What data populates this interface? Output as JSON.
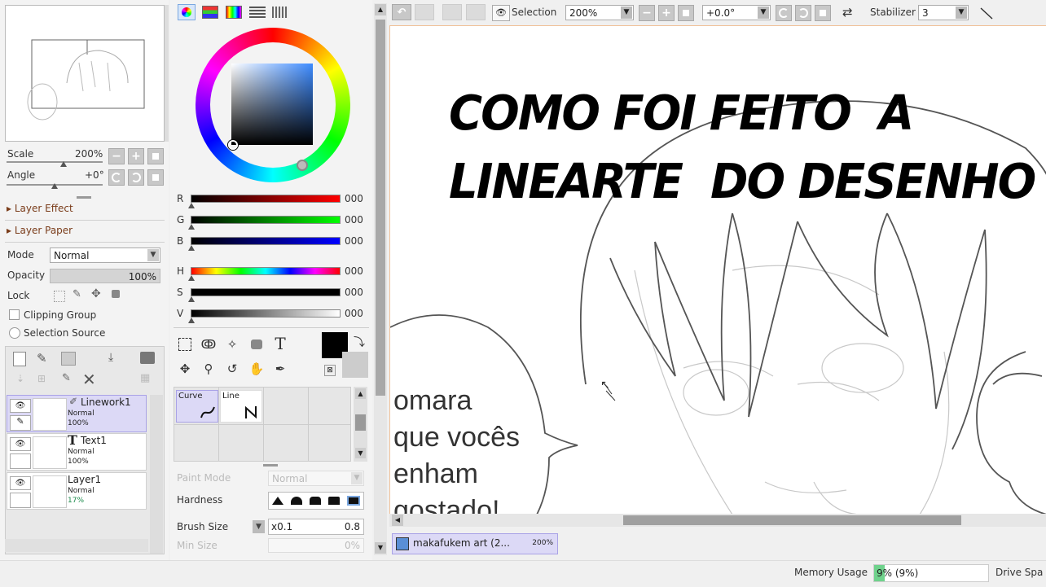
{
  "navigator": {
    "scale_label": "Scale",
    "scale_value": "200%",
    "angle_label": "Angle",
    "angle_value": "+0°"
  },
  "layer_panel": {
    "layer_effect": "Layer Effect",
    "layer_paper": "Layer Paper",
    "mode_label": "Mode",
    "mode_value": "Normal",
    "opacity_label": "Opacity",
    "opacity_value": "100%",
    "lock_label": "Lock",
    "clipping_group": "Clipping Group",
    "selection_source": "Selection Source",
    "layers": [
      {
        "name": "Linework1",
        "mode": "Normal",
        "opacity": "100%"
      },
      {
        "name": "Text1",
        "mode": "Normal",
        "opacity": "100%"
      },
      {
        "name": "Layer1",
        "mode": "Normal",
        "opacity": "17%"
      }
    ]
  },
  "color_panel": {
    "sliders": [
      {
        "label": "R",
        "value": "000"
      },
      {
        "label": "G",
        "value": "000"
      },
      {
        "label": "B",
        "value": "000"
      },
      {
        "label": "H",
        "value": "000"
      },
      {
        "label": "S",
        "value": "000"
      },
      {
        "label": "V",
        "value": "000"
      }
    ]
  },
  "brush_panel": {
    "brushes": [
      {
        "name": "Curve"
      },
      {
        "name": "Line"
      }
    ],
    "paint_mode_label": "Paint Mode",
    "paint_mode_value": "Normal",
    "hardness_label": "Hardness",
    "brush_size_label": "Brush Size",
    "brush_size_mult": "x0.1",
    "brush_size_value": "0.8",
    "min_size_label": "Min Size",
    "min_size_value": "0%"
  },
  "toolbar": {
    "selection_label": "Selection",
    "zoom_value": "200%",
    "rotation_value": "+0.0°",
    "stabilizer_label": "Stabilizer",
    "stabilizer_value": "3"
  },
  "canvas": {
    "title_line1": "COMO FOI FEITO  A",
    "title_line2": "LINEARTE  DO DESENHO",
    "speech_lines": [
      "omara",
      "que vocês",
      "enham",
      "gostado!"
    ]
  },
  "document_tab": {
    "name": "makafukem art (2...",
    "zoom": "200%"
  },
  "status_bar": {
    "memory_label": "Memory Usage",
    "memory_value": "9% (9%)",
    "memory_fraction": 0.09,
    "drive_label": "Drive Spa"
  },
  "colors": {
    "selected_layer_bg": "#dcd9f6",
    "canvas_border": "#f0c29a",
    "scrollbar_thumb": "#a0a0a0"
  }
}
